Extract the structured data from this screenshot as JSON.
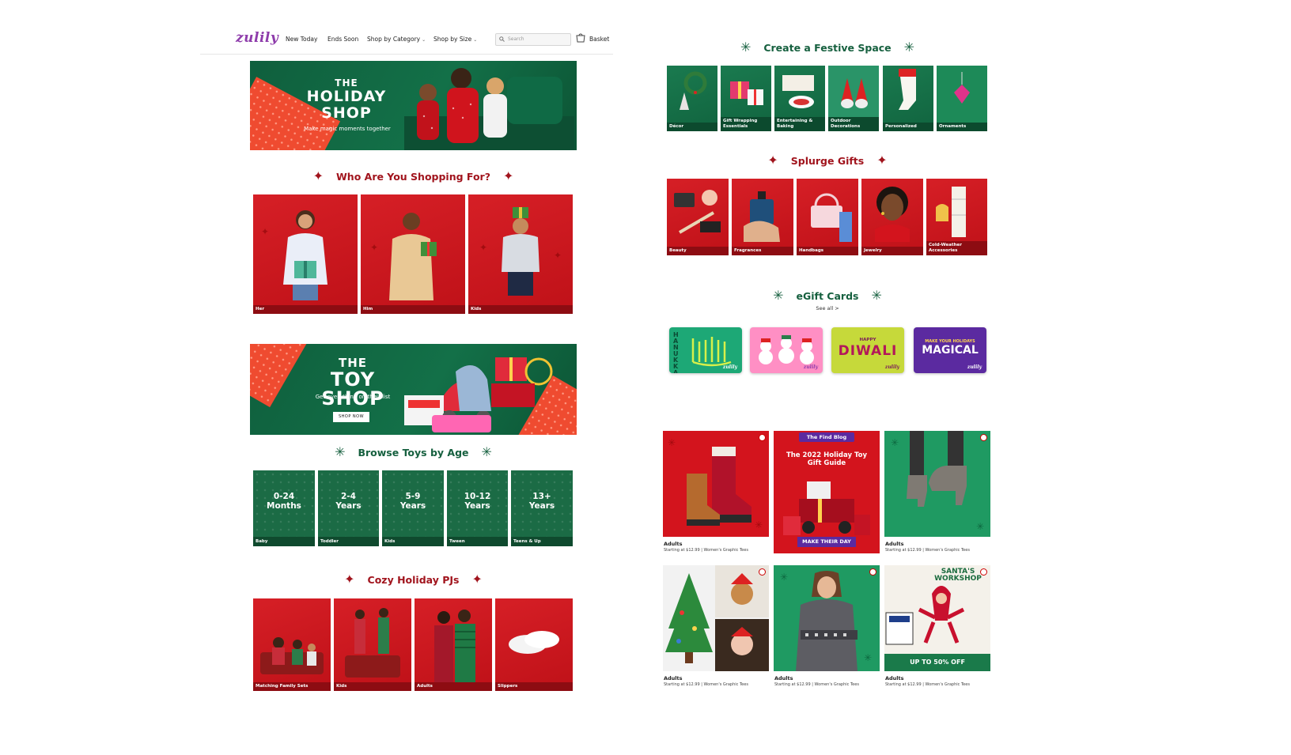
{
  "header": {
    "logo": "zulily",
    "nav": [
      {
        "label": "New Today",
        "dropdown": false
      },
      {
        "label": "Ends Soon",
        "dropdown": false
      },
      {
        "label": "Shop by Category",
        "dropdown": true
      },
      {
        "label": "Shop by Size",
        "dropdown": true
      }
    ],
    "search_placeholder": "Search",
    "basket_label": "Basket"
  },
  "holiday_banner": {
    "title_line1": "THE",
    "title_line2": "HOLIDAY",
    "title_line3": "SHOP",
    "subtitle": "Make magic moments together"
  },
  "shopping_for": {
    "heading": "Who Are You Shopping For?",
    "tiles": [
      "Her",
      "Him",
      "Kids"
    ]
  },
  "toy_banner": {
    "title_line1": "THE",
    "title_line2": "TOY SHOP",
    "subtitle": "Get everything on their list",
    "button": "SHOP NOW"
  },
  "toys_by_age": {
    "heading": "Browse Toys by Age",
    "tiles": [
      {
        "age": "0-24\nMonths",
        "label": "Baby"
      },
      {
        "age": "2-4\nYears",
        "label": "Toddler"
      },
      {
        "age": "5-9\nYears",
        "label": "Kids"
      },
      {
        "age": "10-12\nYears",
        "label": "Tween"
      },
      {
        "age": "13+\nYears",
        "label": "Teens & Up"
      }
    ]
  },
  "cozy_pjs": {
    "heading": "Cozy Holiday PJs",
    "tiles": [
      "Matching Family Sets",
      "Kids",
      "Adults",
      "Slippers"
    ]
  },
  "festive_space": {
    "heading": "Create a Festive Space",
    "tiles": [
      "Décor",
      "Gift Wrapping Essentials",
      "Entertaining & Baking",
      "Outdoor Decorations",
      "Personalized",
      "Ornaments"
    ]
  },
  "splurge_gifts": {
    "heading": "Splurge Gifts",
    "tiles": [
      "Beauty",
      "Fragrances",
      "Handbags",
      "Jewelry",
      "Cold-Weather Accessories"
    ]
  },
  "egift": {
    "heading": "eGift Cards",
    "see_all": "See all >",
    "cards": [
      {
        "text": "HANUKKAH",
        "brand": "zulily",
        "bg": "#1da876"
      },
      {
        "text": "",
        "brand": "zulily",
        "bg": "#ff8fc4"
      },
      {
        "text_small": "HAPPY",
        "text": "DIWALI",
        "brand": "zulily",
        "bg": "#c6d93a"
      },
      {
        "text_small": "MAKE YOUR HOLIDAYS",
        "text": "MAGICAL",
        "brand": "zulily",
        "bg": "#5b2aa0"
      }
    ]
  },
  "products": [
    {
      "title": "Adults",
      "sub": "Starting at $12.99 | Women's Graphic Tees"
    },
    {
      "blog_tag": "The Find Blog",
      "blog_title": "The 2022 Holiday Toy Gift Guide",
      "blog_cta": "MAKE THEIR DAY"
    },
    {
      "title": "Adults",
      "sub": "Starting at $12.99 | Women's Graphic Tees"
    },
    {
      "title": "Adults",
      "sub": "Starting at $12.99 | Women's Graphic Tees"
    },
    {
      "title": "Adults",
      "sub": "Starting at $12.99 | Women's Graphic Tees"
    },
    {
      "title": "Adults",
      "sub": "Starting at $12.99 | Women's Graphic Tees",
      "promo_title": "SANTA'S WORKSHOP",
      "promo_off": "UP TO 50% OFF"
    }
  ],
  "colors": {
    "brand_purple": "#8e3cab",
    "holiday_red": "#a1141d",
    "holiday_green": "#16603f",
    "accent_orange": "#ef4b30"
  },
  "icons": [
    "search-icon",
    "basket-icon",
    "chevron-down-icon",
    "sparkle-star-icon",
    "snowflake-icon"
  ]
}
